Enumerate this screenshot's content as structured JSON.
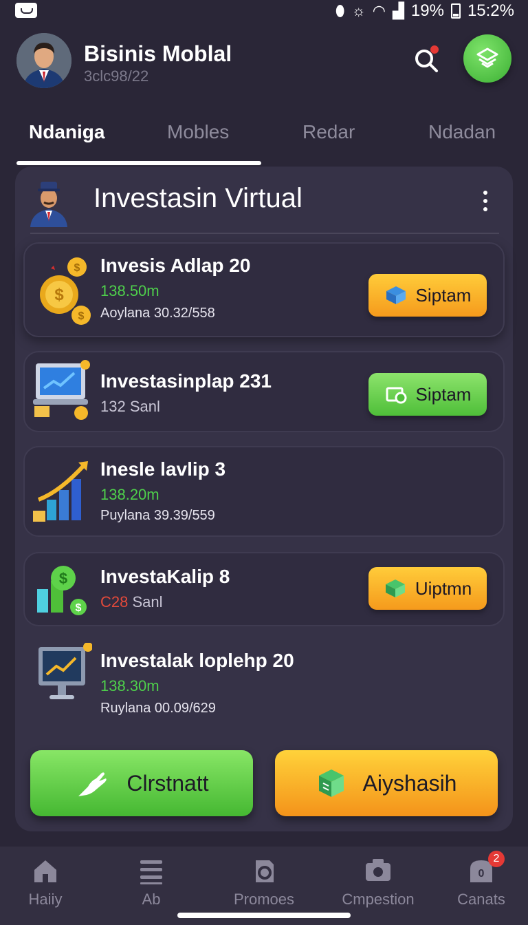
{
  "status_bar": {
    "battery": "19%",
    "time": "15:2%"
  },
  "header": {
    "title": "Bisinis Moblal",
    "subtitle": "3clc98/22"
  },
  "tabs": [
    {
      "label": "Ndaniga",
      "active": true
    },
    {
      "label": "Mobles",
      "active": false
    },
    {
      "label": "Redar",
      "active": false
    },
    {
      "label": "Ndadan",
      "active": false
    }
  ],
  "card": {
    "title": "Investasin Virtual",
    "items": [
      {
        "title": "Invesis Adlap 20",
        "amount": "138.50m",
        "detail": "Aoylana 30.32/558",
        "button": "Siptam",
        "button_color": "#f5a623",
        "icon": "gold-coins-icon"
      },
      {
        "title": "Investasinplap 231",
        "amount": "132 Sanl",
        "button": "Siptam",
        "button_color": "#5ec43f",
        "icon": "laptop-chart-icon"
      },
      {
        "title": "Inesle lavlip 3",
        "amount": "138.20m",
        "detail": "Puylana 39.39/559",
        "icon": "growth-chart-icon"
      },
      {
        "title": "InvestaKalip 8",
        "amount_prefix": "C28",
        "amount_suffix": "Sanl",
        "button": "Uiptmn",
        "button_color": "#f5a623",
        "icon": "money-chart-icon"
      },
      {
        "title": "Investalak loplehp 20",
        "amount": "138.30m",
        "detail": "Ruylana 00.09/629",
        "icon": "monitor-chart-icon"
      }
    ]
  },
  "actions": {
    "primary": "Clrstnatt",
    "secondary": "Aiyshasih"
  },
  "bottom_nav": [
    {
      "label": "Haiiy",
      "icon": "home-icon"
    },
    {
      "label": "Ab",
      "icon": "list-icon"
    },
    {
      "label": "Promoes",
      "icon": "promo-icon"
    },
    {
      "label": "Cmpestion",
      "icon": "camera-icon"
    },
    {
      "label": "Canats",
      "icon": "contacts-icon",
      "badge": "2"
    }
  ],
  "colors": {
    "background": "#2a2637",
    "card": "#363247",
    "accent_green": "#4fbf39",
    "accent_orange": "#f59a1c"
  }
}
